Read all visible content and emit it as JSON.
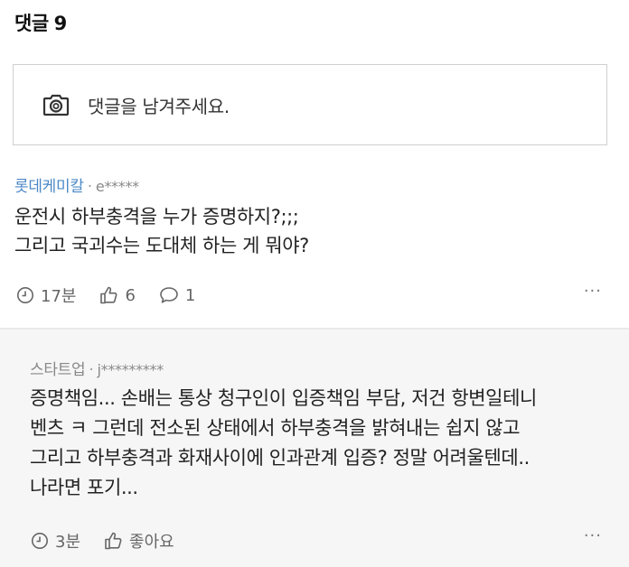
{
  "header": {
    "title": "댓글",
    "count": "9"
  },
  "input": {
    "placeholder": "댓글을 남겨주세요."
  },
  "comments": [
    {
      "nickname": "롯데케미칼",
      "separator": "·",
      "user_id": "e*****",
      "text": "운전시 하부충격을 누가 증명하지?;;;\n그리고 국괴수는 도대체 하는 게 뭐야?",
      "time": "17분",
      "likes": "6",
      "replies": "1",
      "more": "···"
    },
    {
      "nickname": "스타트업",
      "separator": "·",
      "user_id": "j*********",
      "text": "증명책임... 손배는 통상 청구인이 입증책임 부담, 저건 항변일테니\n벤츠 ㅋ 그런데 전소된 상태에서 하부충격을 밝혀내는 쉽지 않고\n그리고 하부충격과 화재사이에 인과관계 입증? 정말 어려울텐데..\n나라면 포기...",
      "time": "3분",
      "like_label": "좋아요",
      "more": "···"
    }
  ],
  "colors": {
    "nickname_accent": "#4b88c6",
    "reply_bg": "#f6f6f6"
  }
}
